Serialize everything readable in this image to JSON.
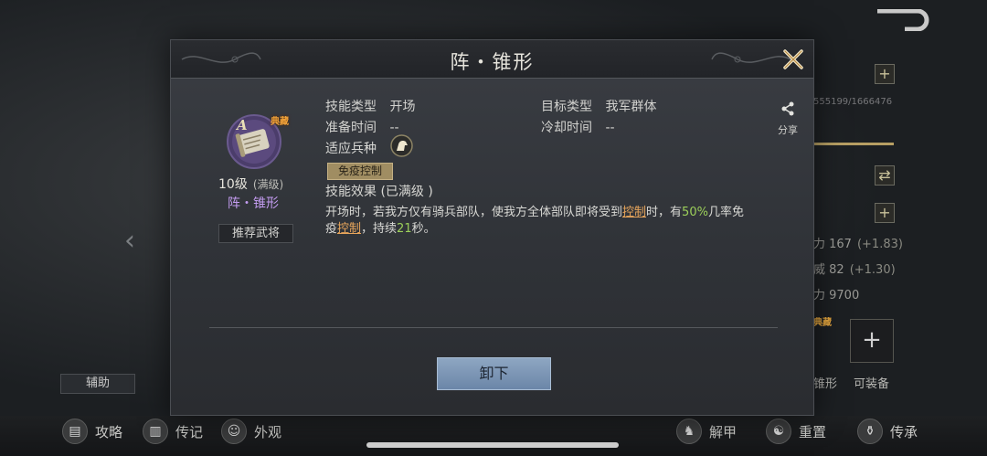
{
  "modal": {
    "title": "阵・锥形",
    "skill": {
      "rank_letter": "A",
      "tag": "典藏",
      "level": "10级",
      "level_max": "(满级)",
      "name": "阵・锥形",
      "recommend_label": "推荐武将"
    },
    "info": {
      "skill_type_label": "技能类型",
      "skill_type_value": "开场",
      "target_type_label": "目标类型",
      "target_type_value": "我军群体",
      "prep_time_label": "准备时间",
      "prep_time_value": "--",
      "cooldown_label": "冷却时间",
      "cooldown_value": "--",
      "troop_label": "适应兵种",
      "troop_icon": "horse-icon",
      "immune_tag": "免疫控制",
      "effect_title": "技能效果 (已满级 )"
    },
    "effect": {
      "part1": "开场时，若我方仅有骑兵部队，使我方全体部队即将受到",
      "link1": "控制",
      "part2": "时，有",
      "percent": "50%",
      "part3": "几率免疫",
      "link2": "控制",
      "part4": "，持续",
      "duration": "21",
      "part5": "秒。"
    },
    "share_label": "分享",
    "unequip_label": "卸下"
  },
  "background": {
    "left_button": "辅助",
    "right_id": "555199/1666476",
    "stats": [
      {
        "label": "力 167",
        "delta": "(+1.83)"
      },
      {
        "label": "威 82",
        "delta": "(+1.30)"
      },
      {
        "label": "力 9700",
        "delta": ""
      }
    ],
    "right_tag": "典藏",
    "right_skill_name": "锥形",
    "equip_label": "可装备"
  },
  "bottom_bar": {
    "items": [
      {
        "label": "攻略",
        "icon": "strategy-icon"
      },
      {
        "label": "传记",
        "icon": "book-icon"
      },
      {
        "label": "外观",
        "icon": "appearance-icon"
      },
      {
        "label": "解甲",
        "icon": "armor-icon"
      },
      {
        "label": "重置",
        "icon": "reset-icon"
      },
      {
        "label": "传承",
        "icon": "inherit-icon"
      }
    ]
  },
  "colors": {
    "accent_purple": "#c39cf0",
    "highlight_orange": "#e7a55b",
    "highlight_green": "#9ccf5a",
    "button_blue": "#7d96b6"
  }
}
